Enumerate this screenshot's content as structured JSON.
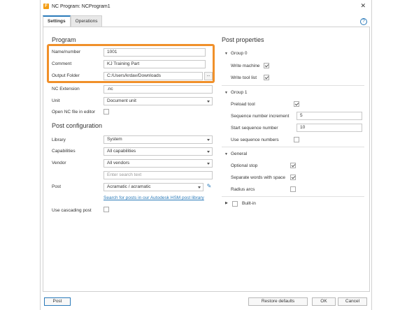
{
  "window": {
    "title": "NC Program: NCProgram1",
    "close_glyph": "✕",
    "app_icon_letter": "F"
  },
  "tabs": [
    {
      "label": "Settings"
    },
    {
      "label": "Operations"
    }
  ],
  "program": {
    "section_title": "Program",
    "name_label": "Name/number",
    "name_value": "1001",
    "comment_label": "Comment",
    "comment_value": "KJ Training Part",
    "output_label": "Output Folder",
    "output_value": "C:/Users/krdav/Downloads",
    "browse_label": "...",
    "ext_label": "NC Extension",
    "ext_value": ".nc",
    "unit_label": "Unit",
    "unit_value": "Document unit",
    "open_label": "Open NC file in editor",
    "open_checked": false
  },
  "post_config": {
    "section_title": "Post configuration",
    "library_label": "Library",
    "library_value": "System",
    "capabilities_label": "Capabilities",
    "capabilities_value": "All capabilities",
    "vendor_label": "Vendor",
    "vendor_value": "All vendors",
    "search_placeholder": "Enter search text",
    "post_label": "Post",
    "post_value": "Acramatic / acramatic",
    "search_link": "Search for posts in our Autodesk HSM post library",
    "cascading_label": "Use cascading post",
    "cascading_checked": false
  },
  "post_properties": {
    "section_title": "Post properties",
    "group0": {
      "label": "Group 0",
      "write_machine_label": "Write machine",
      "write_machine_checked": true,
      "write_tool_list_label": "Write tool list",
      "write_tool_list_checked": true
    },
    "group1": {
      "label": "Group 1",
      "preload_label": "Preload tool",
      "preload_checked": true,
      "seq_inc_label": "Sequence number increment",
      "seq_inc_value": "5",
      "start_seq_label": "Start sequence number",
      "start_seq_value": "10",
      "use_seq_label": "Use sequence numbers",
      "use_seq_checked": false
    },
    "general": {
      "label": "General",
      "optional_stop_label": "Optional stop",
      "optional_stop_checked": true,
      "separate_words_label": "Separate words with space",
      "separate_words_checked": true,
      "radius_arcs_label": "Radius arcs",
      "radius_arcs_checked": false
    },
    "builtin": {
      "label": "Built-in"
    }
  },
  "footer": {
    "post_button": "Post",
    "restore_button": "Restore defaults",
    "ok_button": "OK",
    "cancel_button": "Cancel"
  },
  "colors": {
    "accent": "#2a7ab9",
    "highlight": "#f0902a"
  },
  "icons": {
    "help": "?",
    "pencil": "✎"
  }
}
